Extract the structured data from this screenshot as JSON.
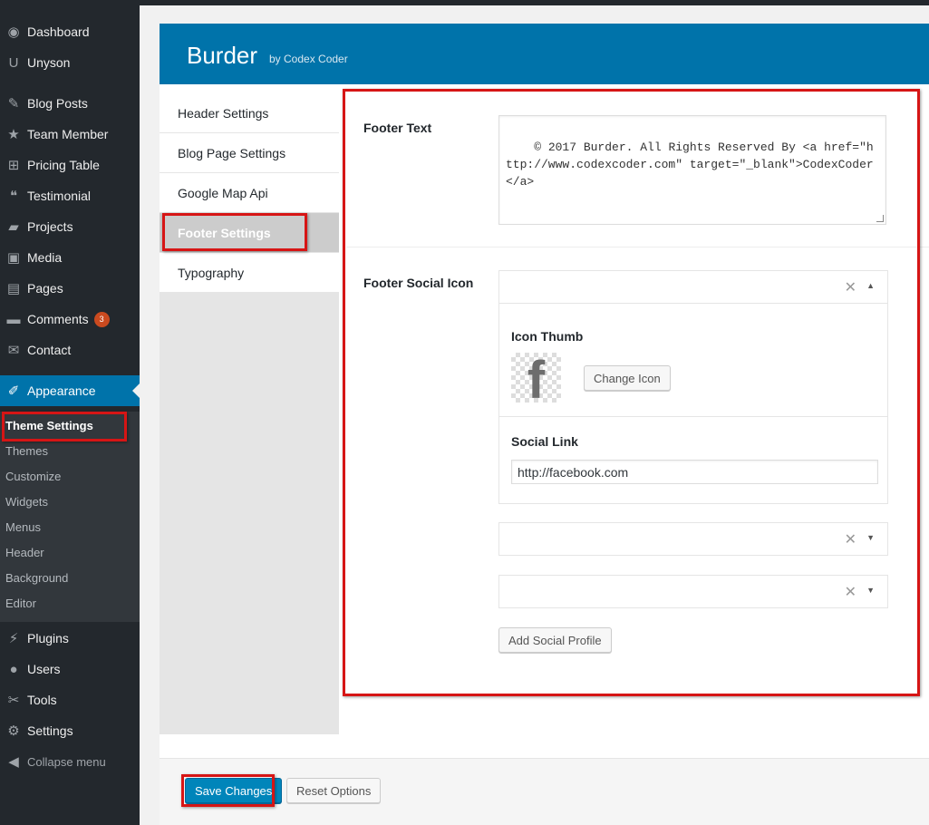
{
  "sidebar": {
    "items": [
      {
        "label": "Dashboard",
        "icon": "dashboard-icon",
        "glyph": "◉"
      },
      {
        "label": "Unyson",
        "icon": "unyson-icon",
        "glyph": "U"
      },
      {
        "label": "Blog Posts",
        "icon": "pin-icon",
        "glyph": "✎"
      },
      {
        "label": "Team Member",
        "icon": "star-icon",
        "glyph": "★"
      },
      {
        "label": "Pricing Table",
        "icon": "sitemap-icon",
        "glyph": "⊞"
      },
      {
        "label": "Testimonial",
        "icon": "quote-icon",
        "glyph": "❝"
      },
      {
        "label": "Projects",
        "icon": "portfolio-icon",
        "glyph": "▰"
      },
      {
        "label": "Media",
        "icon": "media-icon",
        "glyph": "▣"
      },
      {
        "label": "Pages",
        "icon": "pages-icon",
        "glyph": "▤"
      },
      {
        "label": "Comments",
        "icon": "comment-icon",
        "glyph": "▬",
        "badge": "3"
      },
      {
        "label": "Contact",
        "icon": "mail-icon",
        "glyph": "✉"
      },
      {
        "label": "Appearance",
        "icon": "brush-icon",
        "glyph": "✐"
      },
      {
        "label": "Plugins",
        "icon": "plugin-icon",
        "glyph": "⚡"
      },
      {
        "label": "Users",
        "icon": "user-icon",
        "glyph": "●"
      },
      {
        "label": "Tools",
        "icon": "wrench-icon",
        "glyph": "✂"
      },
      {
        "label": "Settings",
        "icon": "settings-icon",
        "glyph": "⚙"
      }
    ],
    "submenu": [
      "Theme Settings",
      "Themes",
      "Customize",
      "Widgets",
      "Menus",
      "Header",
      "Background",
      "Editor"
    ],
    "collapse_label": "Collapse menu",
    "collapse_glyph": "◀"
  },
  "header": {
    "title": "Burder",
    "subtitle": "by Codex Coder"
  },
  "tabs": [
    "Header Settings",
    "Blog Page Settings",
    "Google Map Api",
    "Footer Settings",
    "Typography"
  ],
  "footer_settings": {
    "footer_text_label": "Footer Text",
    "footer_text_value": "© 2017 Burder. All Rights Reserved By <a href=\"http://www.codexcoder.com\" target=\"_blank\">CodexCoder</a>",
    "social_icon_label": "Footer Social Icon",
    "icon_thumb_label": "Icon Thumb",
    "icon_glyph": "f",
    "change_icon_label": "Change Icon",
    "social_link_label": "Social Link",
    "social_link_value": "http://facebook.com",
    "remove_glyph": "✕",
    "caret_up": "▲",
    "caret_down": "▼",
    "add_profile_label": "Add Social Profile"
  },
  "actions": {
    "save_label": "Save Changes",
    "reset_label": "Reset Options"
  },
  "colors": {
    "sidebar": "#23282d",
    "accent": "#0073aa",
    "highlight": "#d61515"
  }
}
